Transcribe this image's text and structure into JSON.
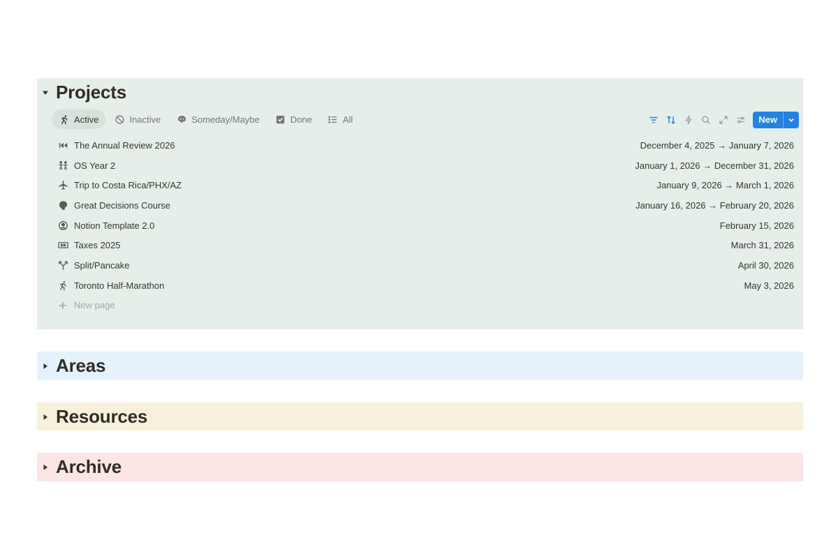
{
  "projects": {
    "title": "Projects",
    "tabs": [
      {
        "label": "Active",
        "icon": "runner-icon"
      },
      {
        "label": "Inactive",
        "icon": "prohibited-icon"
      },
      {
        "label": "Someday/Maybe",
        "icon": "thought-bubble-icon"
      },
      {
        "label": "Done",
        "icon": "checkbox-icon"
      },
      {
        "label": "All",
        "icon": "list-icon"
      }
    ],
    "new_button": "New",
    "rows": [
      {
        "name": "The Annual Review 2026",
        "date": "December 4, 2025 → January 7, 2026",
        "icon": "rewind-icon"
      },
      {
        "name": "OS Year 2",
        "date": "January 1, 2026 → December 31, 2026",
        "icon": "people-icon"
      },
      {
        "name": "Trip to Costa Rica/PHX/AZ",
        "date": "January 9, 2026 → March 1, 2026",
        "icon": "airplane-icon"
      },
      {
        "name": "Great Decisions Course",
        "date": "January 16, 2026 → February 20, 2026",
        "icon": "head-icon"
      },
      {
        "name": "Notion Template 2.0",
        "date": "February 15, 2026",
        "icon": "user-circle-icon"
      },
      {
        "name": "Taxes 2025",
        "date": "March 31, 2026",
        "icon": "money-icon"
      },
      {
        "name": "Split/Pancake",
        "date": "April 30, 2026",
        "icon": "split-icon"
      },
      {
        "name": "Toronto Half-Marathon",
        "date": "May 3, 2026",
        "icon": "runner-icon"
      }
    ],
    "new_page": "New page",
    "background": "#e6eee9"
  },
  "areas": {
    "title": "Areas",
    "background": "#e5f1fb"
  },
  "resources": {
    "title": "Resources",
    "background": "#f7f1dc"
  },
  "archive": {
    "title": "Archive",
    "background": "#fce6e5"
  },
  "accent": "#2383e2"
}
